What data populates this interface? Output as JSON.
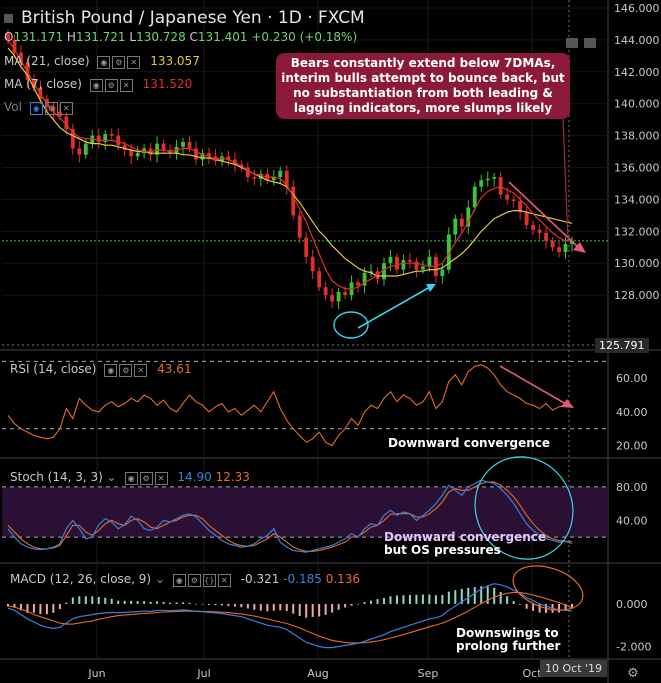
{
  "header": {
    "title": "British Pound / Japanese Yen · 1D · FXCM",
    "ohlc": {
      "o_label": "O",
      "o": "131.171",
      "h_label": "H",
      "h": "131.721",
      "l_label": "L",
      "l": "130.728",
      "c_label": "C",
      "c": "131.401",
      "change": "+0.230 (+0.18%)"
    }
  },
  "indicators": {
    "ma21": {
      "label": "MA (21, close)",
      "value": "133.057"
    },
    "ma7": {
      "label": "MA (7, close)",
      "value": "131.520"
    },
    "vol": {
      "label": "Vol"
    },
    "rsi": {
      "label": "RSI (14, close)",
      "value": "43.61"
    },
    "stoch": {
      "label": "Stoch (14, 3, 3)",
      "k": "14.90",
      "d": "12.33"
    },
    "macd": {
      "label": "MACD (12, 26, close, 9)",
      "macd": "-0.321",
      "signal": "-0.185",
      "hist": "0.136"
    }
  },
  "annotations": {
    "callout": "Bears constantly extend below 7DMAs, interim bulls attempt to bounce back, but no substantiation from both leading & lagging indicators, more slumps likely",
    "rsi_note": "Downward convergence",
    "stoch_note1": "Downward convergence",
    "stoch_note2": "but OS pressures",
    "macd_note1": "Downswings to",
    "macd_note2": "prolong further"
  },
  "crosshair_date": "10 Oct '19",
  "current_price_label": "125.791",
  "colors": {
    "up": "#3ac43a",
    "down": "#e0302a",
    "ma21": "#e8c83a",
    "ma7": "#e0302a",
    "osc": "#e86a2a",
    "stoch_k": "#3b7fd9",
    "stoch_d": "#e86a2a",
    "callout_bg": "#8b1a3a",
    "cyan": "#3ad4e8",
    "pink": "#e05a7a"
  },
  "chart_data": [
    {
      "type": "candlestick",
      "title": "British Pound / Japanese Yen · 1D · FXCM",
      "x": [
        "Jun",
        "Jul",
        "Aug",
        "Sep",
        "Oct"
      ],
      "yticks": [
        128,
        130,
        132,
        134,
        136,
        138,
        140,
        142,
        144,
        146
      ],
      "ylim": [
        125.0,
        146.0
      ],
      "close_series": [
        144.0,
        143.2,
        142.6,
        141.5,
        141.0,
        140.3,
        139.8,
        139.5,
        139.2,
        138.4,
        137.2,
        136.8,
        137.5,
        138.0,
        137.6,
        138.1,
        138.0,
        137.4,
        137.1,
        136.7,
        136.9,
        137.2,
        136.8,
        137.5,
        137.1,
        136.9,
        137.3,
        137.6,
        137.2,
        136.5,
        136.9,
        136.7,
        136.4,
        136.7,
        136.5,
        136.2,
        136.0,
        135.4,
        135.3,
        135.6,
        135.2,
        135.4,
        135.8,
        134.8,
        133.0,
        131.6,
        130.4,
        129.5,
        128.5,
        128.0,
        127.6,
        128.2,
        128.0,
        128.8,
        128.6,
        129.4,
        129.5,
        129.0,
        130.0,
        130.4,
        129.6,
        130.2,
        130.1,
        129.6,
        129.8,
        130.4,
        129.2,
        129.6,
        131.8,
        132.8,
        132.3,
        133.5,
        134.8,
        135.2,
        135.3,
        135.4,
        134.3,
        134.0,
        133.9,
        133.2,
        132.4,
        132.1,
        131.9,
        131.4,
        131.0,
        130.7,
        131.2,
        131.4
      ],
      "ma21": [
        143.5,
        143.0,
        142.3,
        141.8,
        141.0,
        140.2,
        139.5,
        139.0,
        138.5,
        138.2,
        138.0,
        137.8,
        137.6,
        137.5,
        137.5,
        137.4,
        137.4,
        137.3,
        137.2,
        137.1,
        137.0,
        137.0,
        136.9,
        136.9,
        136.9,
        136.9,
        136.9,
        136.8,
        136.8,
        136.7,
        136.6,
        136.6,
        136.5,
        136.4,
        136.3,
        136.2,
        136.0,
        135.8,
        135.6,
        135.4,
        135.2,
        135.1,
        135.0,
        134.8,
        134.3,
        133.8,
        133.2,
        132.6,
        132.0,
        131.6,
        131.1,
        130.7,
        130.3,
        130.0,
        129.7,
        129.5,
        129.4,
        129.2,
        129.2,
        129.2,
        129.2,
        129.3,
        129.4,
        129.5,
        129.5,
        129.6,
        129.6,
        129.7,
        130.0,
        130.3,
        130.6,
        131.0,
        131.5,
        132.0,
        132.4,
        132.8,
        133.0,
        133.2,
        133.3,
        133.3,
        133.2,
        133.1,
        133.0,
        132.9,
        132.8,
        132.7,
        132.6,
        132.5
      ],
      "ma7": [
        144.0,
        143.4,
        142.7,
        142.0,
        141.3,
        140.6,
        140.0,
        139.5,
        139.1,
        138.7,
        138.2,
        137.9,
        137.8,
        137.8,
        137.7,
        137.7,
        137.7,
        137.6,
        137.5,
        137.3,
        137.1,
        137.0,
        137.0,
        137.1,
        137.1,
        137.0,
        137.1,
        137.2,
        137.2,
        137.0,
        136.8,
        136.7,
        136.5,
        136.6,
        136.5,
        136.3,
        136.1,
        135.8,
        135.6,
        135.5,
        135.4,
        135.4,
        135.3,
        134.9,
        134.2,
        133.4,
        132.6,
        131.6,
        130.6,
        129.6,
        128.9,
        128.6,
        128.4,
        128.4,
        128.5,
        128.8,
        129.0,
        129.3,
        129.6,
        129.8,
        129.9,
        130.0,
        130.0,
        130.0,
        129.9,
        129.8,
        129.8,
        130.0,
        130.6,
        131.3,
        131.9,
        132.6,
        133.4,
        134.1,
        134.5,
        134.7,
        134.8,
        134.6,
        134.4,
        134.0,
        133.6,
        133.1,
        132.7,
        132.3,
        131.9,
        131.6,
        131.4,
        131.5
      ]
    },
    {
      "type": "line",
      "name": "RSI (14, close)",
      "yticks": [
        20,
        40,
        60
      ],
      "ylim": [
        15,
        72
      ],
      "levels": [
        70,
        30
      ],
      "values": [
        38,
        33,
        30,
        28,
        26,
        25,
        24,
        25,
        30,
        42,
        36,
        48,
        44,
        41,
        40,
        44,
        46,
        43,
        45,
        48,
        46,
        50,
        48,
        44,
        47,
        42,
        40,
        45,
        50,
        46,
        44,
        40,
        43,
        45,
        40,
        42,
        38,
        41,
        44,
        40,
        46,
        52,
        42,
        35,
        30,
        26,
        22,
        24,
        28,
        22,
        20,
        26,
        30,
        36,
        32,
        40,
        44,
        42,
        48,
        52,
        46,
        50,
        48,
        44,
        46,
        52,
        42,
        46,
        58,
        62,
        56,
        64,
        67,
        68,
        66,
        62,
        56,
        52,
        50,
        48,
        45,
        44,
        42,
        45,
        41,
        43,
        44,
        43.6
      ]
    },
    {
      "type": "line",
      "name": "Stoch (14, 3, 3)",
      "yticks": [
        40,
        80
      ],
      "ylim": [
        -5,
        105
      ],
      "levels": [
        80,
        20
      ],
      "k": [
        30,
        20,
        12,
        8,
        6,
        5,
        6,
        8,
        12,
        30,
        40,
        30,
        18,
        20,
        35,
        42,
        38,
        30,
        35,
        45,
        40,
        30,
        28,
        32,
        40,
        38,
        42,
        46,
        48,
        44,
        36,
        28,
        22,
        16,
        12,
        10,
        8,
        9,
        12,
        18,
        22,
        30,
        14,
        8,
        4,
        3,
        2,
        4,
        6,
        8,
        10,
        14,
        18,
        24,
        20,
        30,
        36,
        34,
        46,
        52,
        46,
        50,
        48,
        40,
        46,
        52,
        60,
        70,
        82,
        76,
        70,
        80,
        84,
        88,
        86,
        84,
        78,
        70,
        60,
        48,
        36,
        28,
        22,
        18,
        16,
        14,
        15,
        14.9
      ],
      "d": [
        34,
        26,
        18,
        12,
        8,
        6,
        6,
        7,
        10,
        22,
        34,
        34,
        26,
        22,
        28,
        36,
        40,
        36,
        34,
        40,
        42,
        38,
        32,
        30,
        34,
        38,
        40,
        44,
        46,
        46,
        42,
        34,
        28,
        22,
        16,
        12,
        10,
        9,
        10,
        14,
        18,
        24,
        20,
        14,
        8,
        5,
        3,
        3,
        4,
        6,
        8,
        11,
        14,
        20,
        21,
        26,
        32,
        34,
        40,
        47,
        48,
        48,
        48,
        44,
        44,
        48,
        54,
        62,
        74,
        78,
        76,
        76,
        80,
        84,
        86,
        86,
        82,
        76,
        68,
        58,
        46,
        36,
        28,
        22,
        18,
        16,
        15,
        12.33
      ]
    },
    {
      "type": "line",
      "name": "MACD (12, 26, close, 9)",
      "yticks": [
        0.0,
        -2.0
      ],
      "ylim": [
        -2.4,
        1.5
      ],
      "macd": [
        -0.2,
        -0.3,
        -0.5,
        -0.7,
        -0.85,
        -1.0,
        -1.1,
        -1.15,
        -1.1,
        -0.9,
        -0.7,
        -0.6,
        -0.55,
        -0.5,
        -0.45,
        -0.42,
        -0.4,
        -0.42,
        -0.4,
        -0.38,
        -0.36,
        -0.34,
        -0.35,
        -0.3,
        -0.3,
        -0.32,
        -0.3,
        -0.28,
        -0.3,
        -0.35,
        -0.36,
        -0.4,
        -0.42,
        -0.45,
        -0.5,
        -0.55,
        -0.6,
        -0.7,
        -0.8,
        -0.9,
        -1.0,
        -1.05,
        -1.1,
        -1.2,
        -1.4,
        -1.6,
        -1.8,
        -1.9,
        -2.0,
        -2.05,
        -2.05,
        -2.0,
        -1.95,
        -1.9,
        -1.85,
        -1.75,
        -1.65,
        -1.55,
        -1.45,
        -1.3,
        -1.2,
        -1.1,
        -1.0,
        -0.9,
        -0.8,
        -0.7,
        -0.65,
        -0.55,
        -0.3,
        -0.1,
        0.1,
        0.3,
        0.5,
        0.7,
        0.85,
        0.95,
        0.9,
        0.8,
        0.65,
        0.5,
        0.3,
        0.15,
        0.0,
        -0.1,
        -0.2,
        -0.28,
        -0.3,
        -0.321
      ],
      "signal": [
        -0.1,
        -0.15,
        -0.25,
        -0.35,
        -0.5,
        -0.6,
        -0.7,
        -0.8,
        -0.9,
        -0.95,
        -0.95,
        -0.9,
        -0.85,
        -0.8,
        -0.72,
        -0.66,
        -0.6,
        -0.55,
        -0.52,
        -0.5,
        -0.47,
        -0.45,
        -0.43,
        -0.4,
        -0.38,
        -0.37,
        -0.36,
        -0.34,
        -0.34,
        -0.34,
        -0.35,
        -0.36,
        -0.37,
        -0.39,
        -0.41,
        -0.44,
        -0.47,
        -0.52,
        -0.57,
        -0.64,
        -0.71,
        -0.78,
        -0.85,
        -0.92,
        -1.02,
        -1.13,
        -1.26,
        -1.39,
        -1.51,
        -1.62,
        -1.71,
        -1.77,
        -1.81,
        -1.83,
        -1.83,
        -1.82,
        -1.78,
        -1.74,
        -1.68,
        -1.6,
        -1.53,
        -1.44,
        -1.35,
        -1.26,
        -1.17,
        -1.07,
        -0.99,
        -0.9,
        -0.78,
        -0.64,
        -0.49,
        -0.33,
        -0.16,
        0.01,
        0.17,
        0.32,
        0.43,
        0.5,
        0.54,
        0.53,
        0.49,
        0.42,
        0.34,
        0.25,
        0.15,
        0.06,
        -0.05,
        -0.185
      ]
    }
  ]
}
